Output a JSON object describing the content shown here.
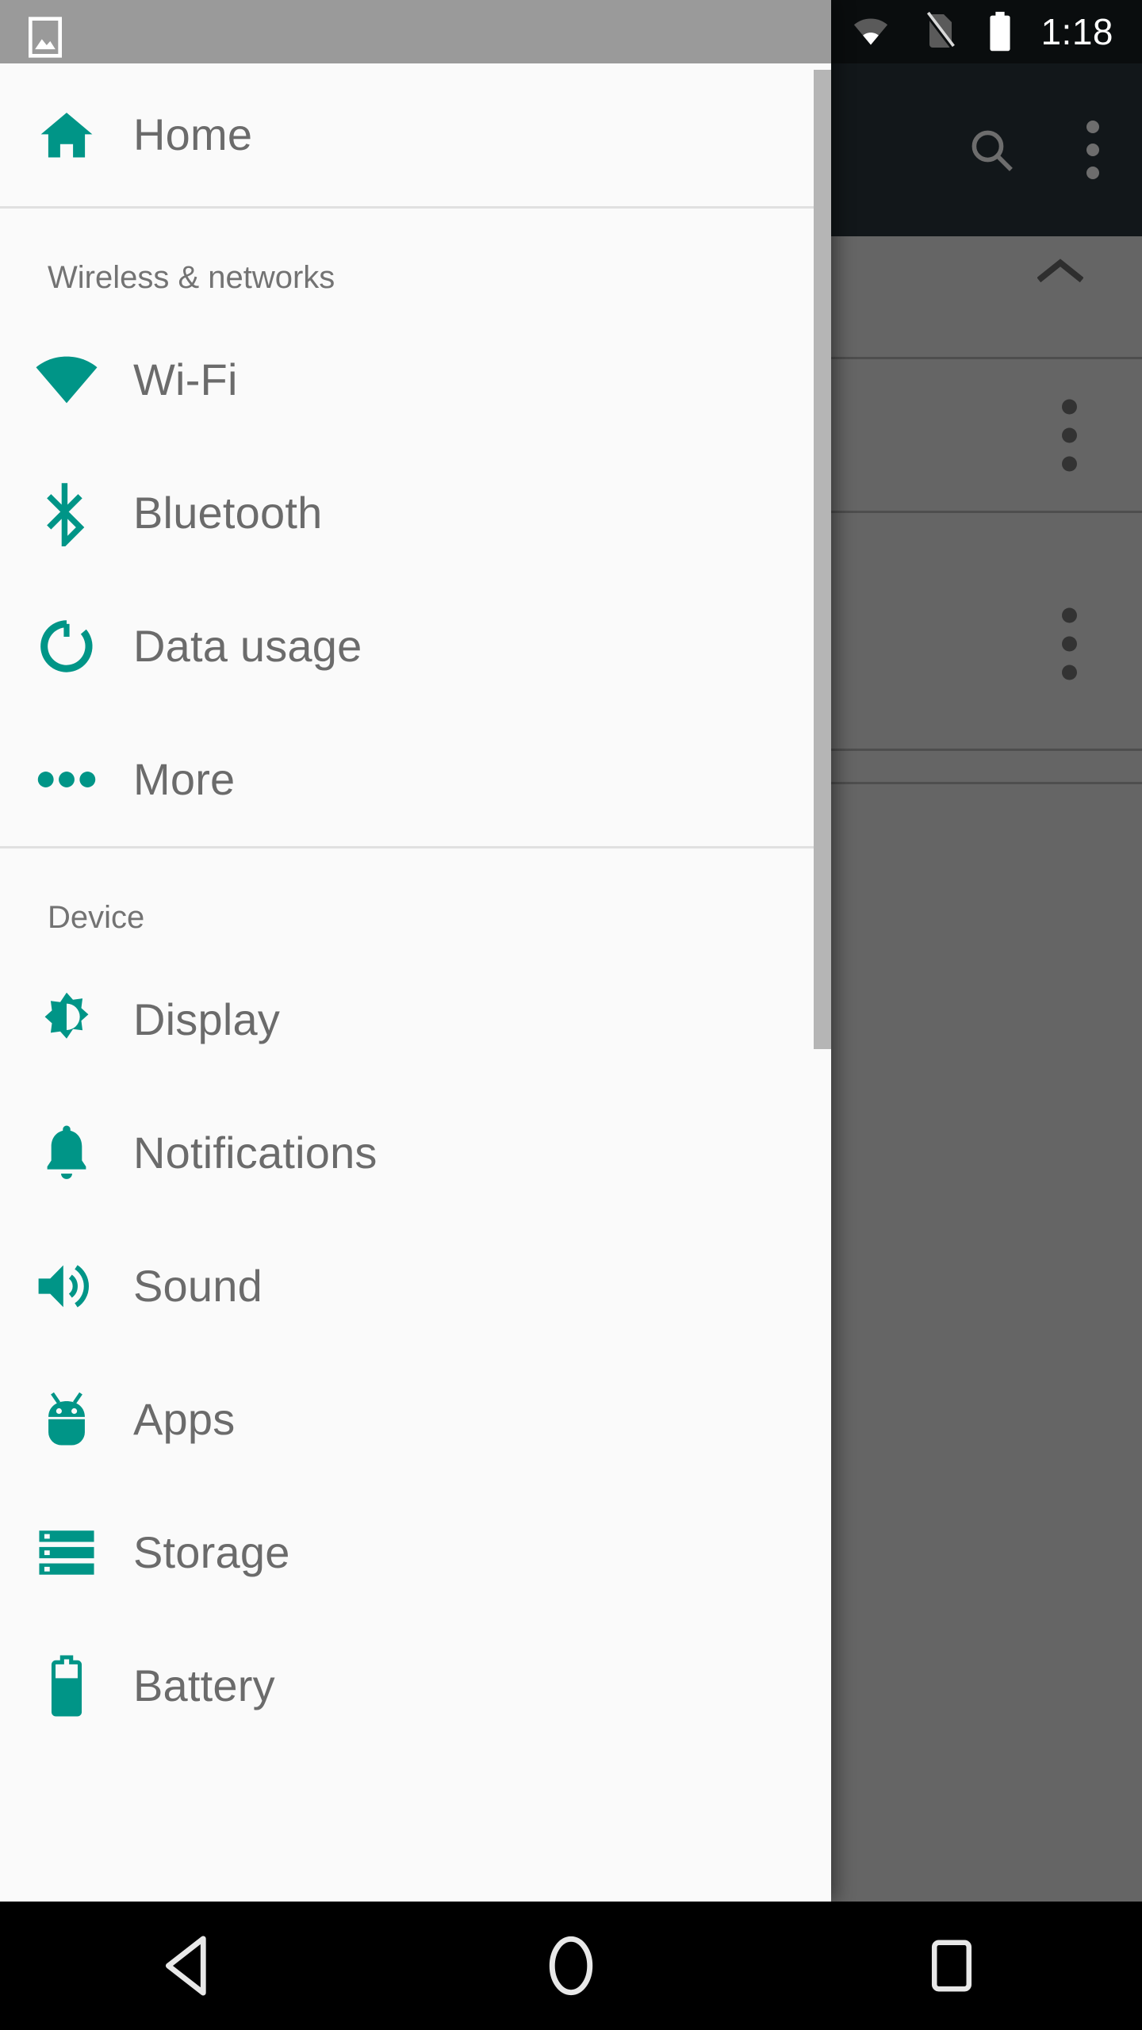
{
  "status_bar": {
    "time": "1:18",
    "icons": [
      "wifi-icon",
      "no-sim-icon",
      "battery-full-icon"
    ]
  },
  "drawer": {
    "placeholder_icon": "broken-image-icon",
    "home": {
      "icon": "home-icon",
      "label": "Home"
    },
    "sections": [
      {
        "header": "Wireless & networks",
        "items": [
          {
            "icon": "wifi-icon",
            "label": "Wi-Fi"
          },
          {
            "icon": "bluetooth-icon",
            "label": "Bluetooth"
          },
          {
            "icon": "data-usage-icon",
            "label": "Data usage"
          },
          {
            "icon": "more-icon",
            "label": "More"
          }
        ]
      },
      {
        "header": "Device",
        "items": [
          {
            "icon": "brightness-icon",
            "label": "Display"
          },
          {
            "icon": "bell-icon",
            "label": "Notifications"
          },
          {
            "icon": "volume-up-icon",
            "label": "Sound"
          },
          {
            "icon": "android-icon",
            "label": "Apps"
          },
          {
            "icon": "storage-icon",
            "label": "Storage"
          },
          {
            "icon": "battery-icon",
            "label": "Battery"
          }
        ]
      }
    ]
  },
  "background_app": {
    "appbar_actions": [
      {
        "icon": "search-icon",
        "label": "Search"
      },
      {
        "icon": "overflow-menu-icon",
        "label": "More options"
      }
    ],
    "collapse": {
      "icon": "chevron-up-icon",
      "label": "Collapse"
    },
    "rows": [
      {
        "icon": "overflow-menu-icon",
        "label": ""
      },
      {
        "icon": "overflow-menu-icon",
        "label": ""
      }
    ]
  },
  "nav_bar": {
    "buttons": [
      {
        "icon": "back-triangle-icon",
        "label": "Back"
      },
      {
        "icon": "home-circle-icon",
        "label": "Home"
      },
      {
        "icon": "recents-square-icon",
        "label": "Recents"
      }
    ]
  },
  "colors": {
    "accent_teal": "#009587",
    "drawer_bg": "#fafafa",
    "label_gray": "#6b6b6b",
    "header_gray": "#737373",
    "divider": "#e0e0e0",
    "scrim": "#656565",
    "appbar_dark": "#12171a",
    "statusbar_dark": "#0a0d0e",
    "drawer_statusbar_gray": "#9a9a9a",
    "navbar_black": "#000000"
  }
}
